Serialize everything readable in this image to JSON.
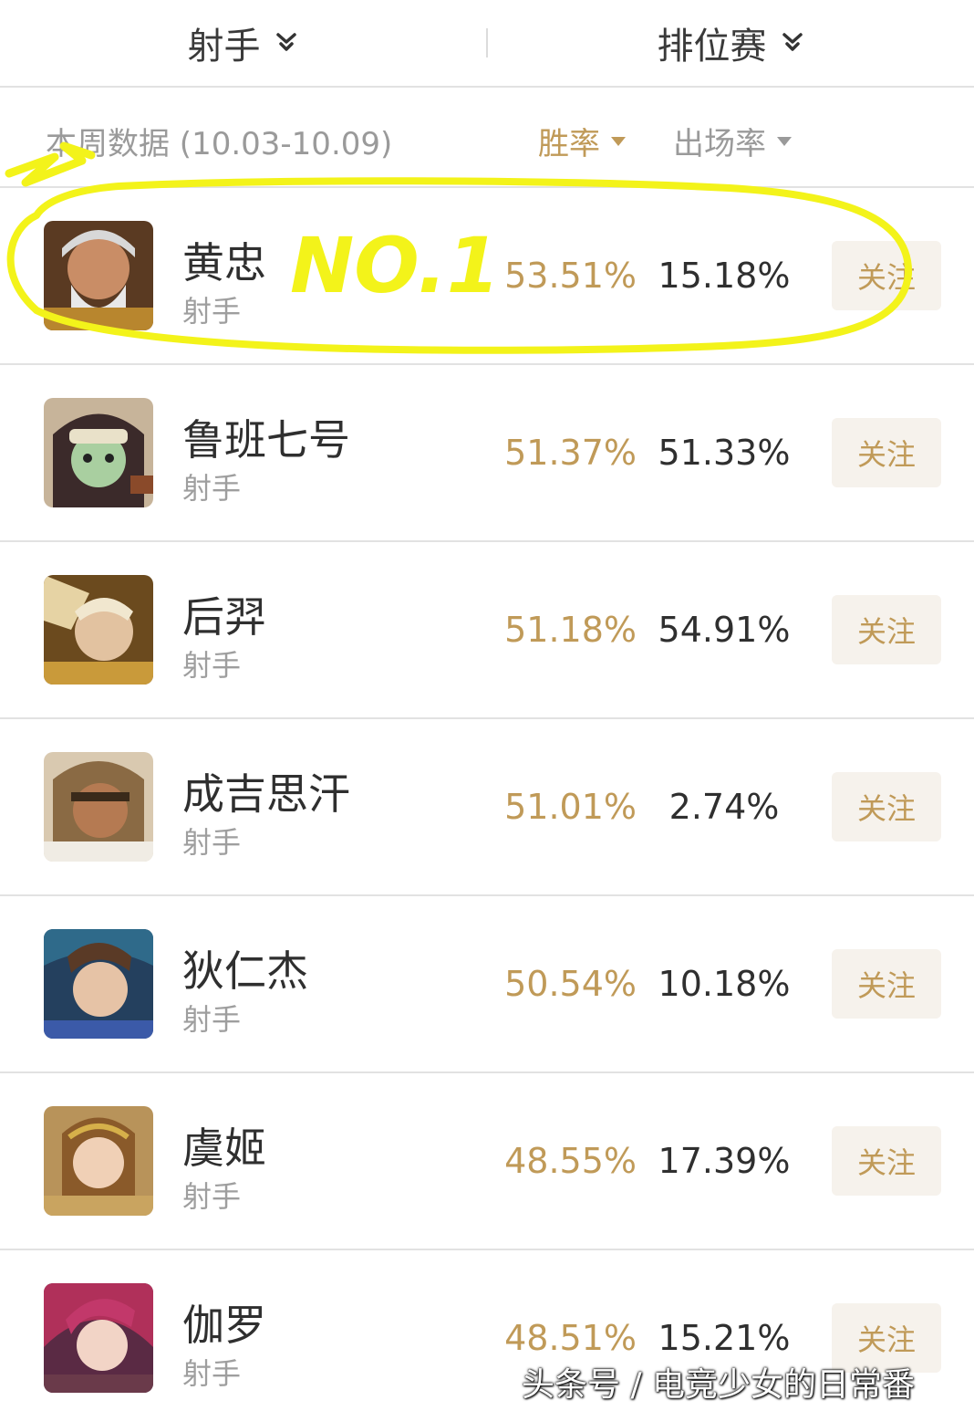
{
  "filters": {
    "role": "射手",
    "mode": "排位赛"
  },
  "subheader": {
    "period": "本周数据 (10.03-10.09)",
    "sort_winrate": "胜率",
    "sort_pickrate": "出场率"
  },
  "heroes": [
    {
      "name": "黄忠",
      "role": "射手",
      "win_rate": "53.51%",
      "pick_rate": "15.18%",
      "follow": "关注"
    },
    {
      "name": "鲁班七号",
      "role": "射手",
      "win_rate": "51.37%",
      "pick_rate": "51.33%",
      "follow": "关注"
    },
    {
      "name": "后羿",
      "role": "射手",
      "win_rate": "51.18%",
      "pick_rate": "54.91%",
      "follow": "关注"
    },
    {
      "name": "成吉思汗",
      "role": "射手",
      "win_rate": "51.01%",
      "pick_rate": "2.74%",
      "follow": "关注"
    },
    {
      "name": "狄仁杰",
      "role": "射手",
      "win_rate": "50.54%",
      "pick_rate": "10.18%",
      "follow": "关注"
    },
    {
      "name": "虞姬",
      "role": "射手",
      "win_rate": "48.55%",
      "pick_rate": "17.39%",
      "follow": "关注"
    },
    {
      "name": "伽罗",
      "role": "射手",
      "win_rate": "48.51%",
      "pick_rate": "15.21%",
      "follow": "关注"
    }
  ],
  "annotation": {
    "text": "NO.1",
    "color": "#f3f31a"
  },
  "watermark": "头条号 / 电竞少女的日常番",
  "colors": {
    "accent": "#c09a58",
    "follow_bg": "#f6f2ec",
    "divider": "#e2e2e2"
  }
}
